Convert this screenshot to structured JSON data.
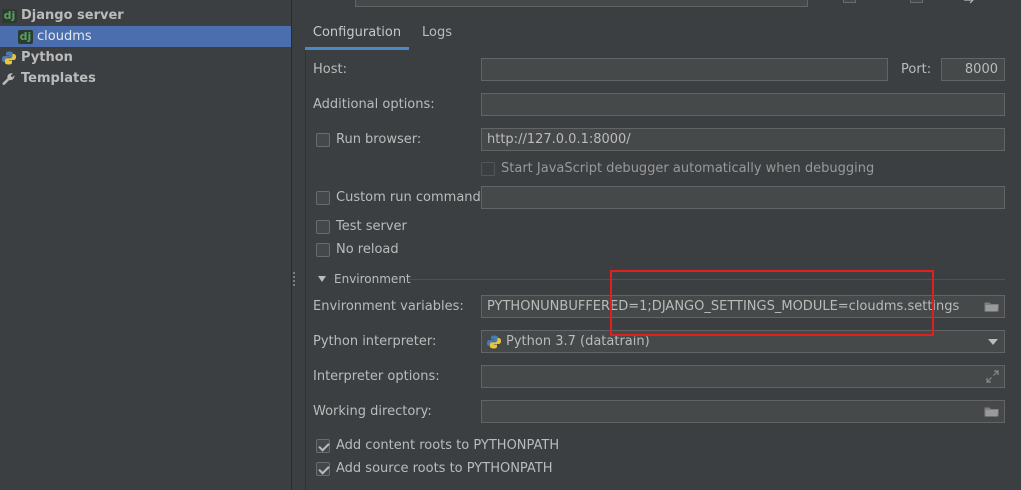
{
  "tree": {
    "items": [
      {
        "label": "Django server",
        "icon": "django-icon"
      },
      {
        "label": "cloudms",
        "icon": "django-icon"
      },
      {
        "label": "Python",
        "icon": "python-icon"
      },
      {
        "label": "Templates",
        "icon": "wrench-icon"
      }
    ]
  },
  "tabs": {
    "configuration": "Configuration",
    "logs": "Logs"
  },
  "form": {
    "host_label": "Host:",
    "host_value": "",
    "port_label": "Port:",
    "port_value": "8000",
    "additional_options_label": "Additional options:",
    "additional_options_value": "",
    "run_browser_label": "Run browser:",
    "run_browser_url": "http://127.0.0.1:8000/",
    "js_debugger_label": "Start JavaScript debugger automatically when debugging",
    "custom_run_label": "Custom run command:",
    "custom_run_value": "",
    "test_server_label": "Test server",
    "no_reload_label": "No reload",
    "environment_label": "Environment",
    "env_vars_label": "Environment variables:",
    "env_vars_value": "PYTHONUNBUFFERED=1;DJANGO_SETTINGS_MODULE=cloudms.settings",
    "interpreter_label": "Python interpreter:",
    "interpreter_value": "Python 3.7 (datatrain)",
    "interpreter_options_label": "Interpreter options:",
    "interpreter_options_value": "",
    "working_dir_label": "Working directory:",
    "working_dir_value": "",
    "content_roots_label": "Add content roots to PYTHONPATH",
    "source_roots_label": "Add source roots to PYTHONPATH"
  },
  "colors": {
    "selection": "#4b6eaf",
    "tab_accent": "#4a88c7",
    "highlight_box": "#e02020"
  }
}
